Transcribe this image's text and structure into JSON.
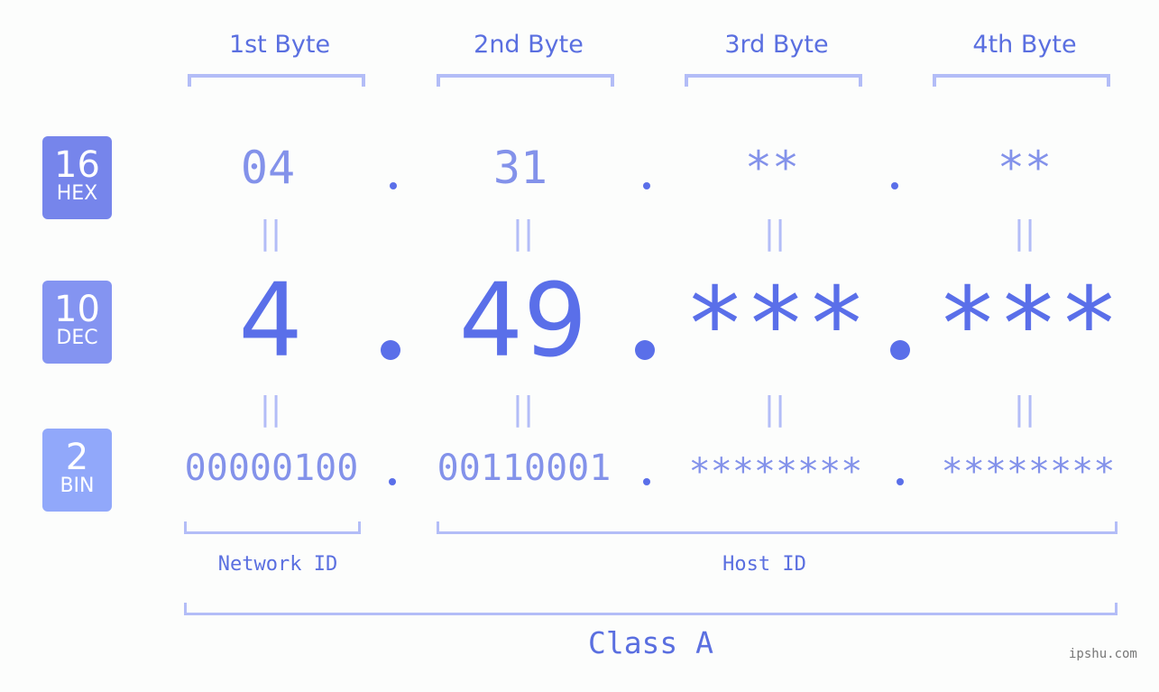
{
  "bytes": {
    "headers": [
      "1st Byte",
      "2nd Byte",
      "3rd Byte",
      "4th Byte"
    ]
  },
  "rows": {
    "hex": {
      "base": "16",
      "label": "HEX",
      "color": "#7685eb",
      "values": [
        "04",
        "31",
        "**",
        "**"
      ]
    },
    "dec": {
      "base": "10",
      "label": "DEC",
      "color": "#8494f1",
      "values": [
        "4",
        "49",
        "***",
        "***"
      ]
    },
    "bin": {
      "base": "2",
      "label": "BIN",
      "color": "#91a8fa",
      "values": [
        "00000100",
        "00110001",
        "********",
        "********"
      ]
    }
  },
  "equals_symbol": "||",
  "separator": ".",
  "network_id_label": "Network ID",
  "host_id_label": "Host ID",
  "class_label": "Class A",
  "watermark": "ipshu.com",
  "colors": {
    "accent": "#5a6fe9",
    "bracket": "#b3bdf7",
    "light_value": "#8392ea"
  }
}
